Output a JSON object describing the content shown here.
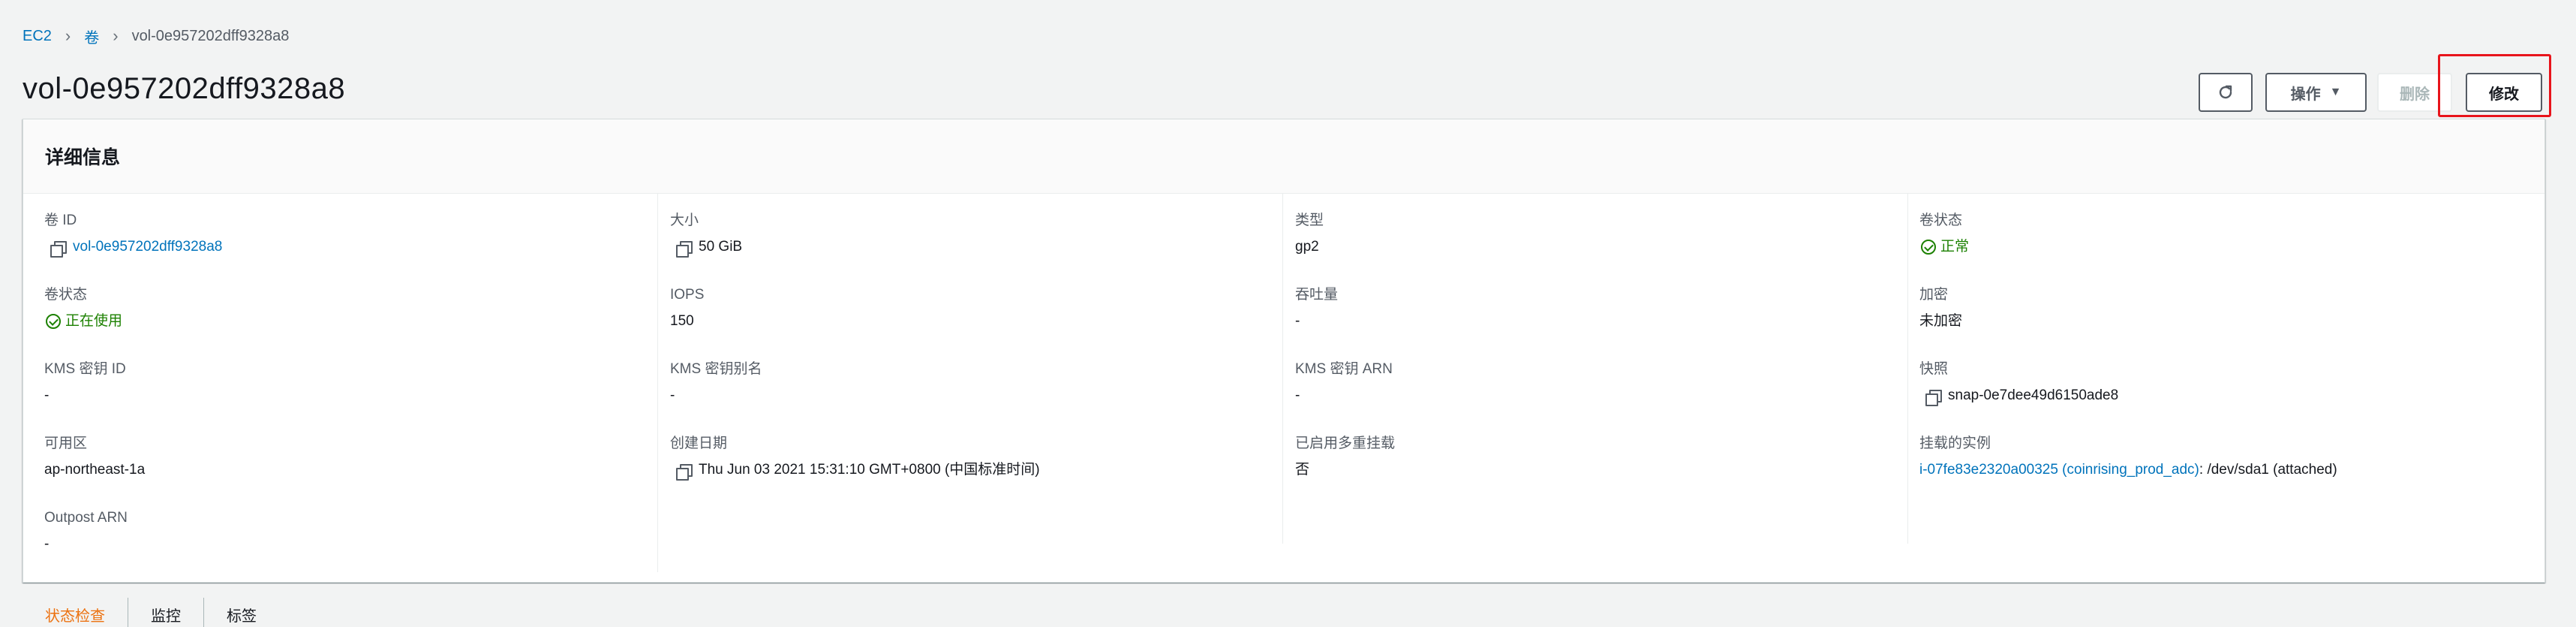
{
  "breadcrumb": {
    "root": "EC2",
    "section": "卷",
    "current": "vol-0e957202dff9328a8"
  },
  "page_title": "vol-0e957202dff9328a8",
  "toolbar": {
    "actions_label": "操作",
    "delete_label": "删除",
    "modify_label": "修改"
  },
  "details": {
    "title": "详细信息",
    "volume_id_label": "卷 ID",
    "volume_id_value": "vol-0e957202dff9328a8",
    "size_label": "大小",
    "size_value": "50 GiB",
    "type_label": "类型",
    "type_value": "gp2",
    "volume_status_label": "卷状态",
    "volume_status_value": "正常",
    "volume_state_label": "卷状态",
    "volume_state_value": "正在使用",
    "iops_label": "IOPS",
    "iops_value": "150",
    "throughput_label": "吞吐量",
    "throughput_value": "-",
    "encryption_label": "加密",
    "encryption_value": "未加密",
    "kms_key_id_label": "KMS 密钥 ID",
    "kms_key_id_value": "-",
    "kms_key_alias_label": "KMS 密钥别名",
    "kms_key_alias_value": "-",
    "kms_key_arn_label": "KMS 密钥 ARN",
    "kms_key_arn_value": "-",
    "snapshot_label": "快照",
    "snapshot_value": "snap-0e7dee49d6150ade8",
    "az_label": "可用区",
    "az_value": "ap-northeast-1a",
    "created_label": "创建日期",
    "created_value": "Thu Jun 03 2021 15:31:10 GMT+0800 (中国标准时间)",
    "multi_attach_label": "已启用多重挂载",
    "multi_attach_value": "否",
    "attached_label": "挂载的实例",
    "attached_instance_link": "i-07fe83e2320a00325 (coinrising_prod_adc)",
    "attached_instance_suffix": ": /dev/sda1 (attached)",
    "outpost_label": "Outpost ARN",
    "outpost_value": "-"
  },
  "tabs": [
    "状态检查",
    "监控",
    "标签"
  ],
  "colors": {
    "link": "#0073bb",
    "success": "#1d8102",
    "active_tab": "#ec7211",
    "highlight": "#e8141b"
  }
}
